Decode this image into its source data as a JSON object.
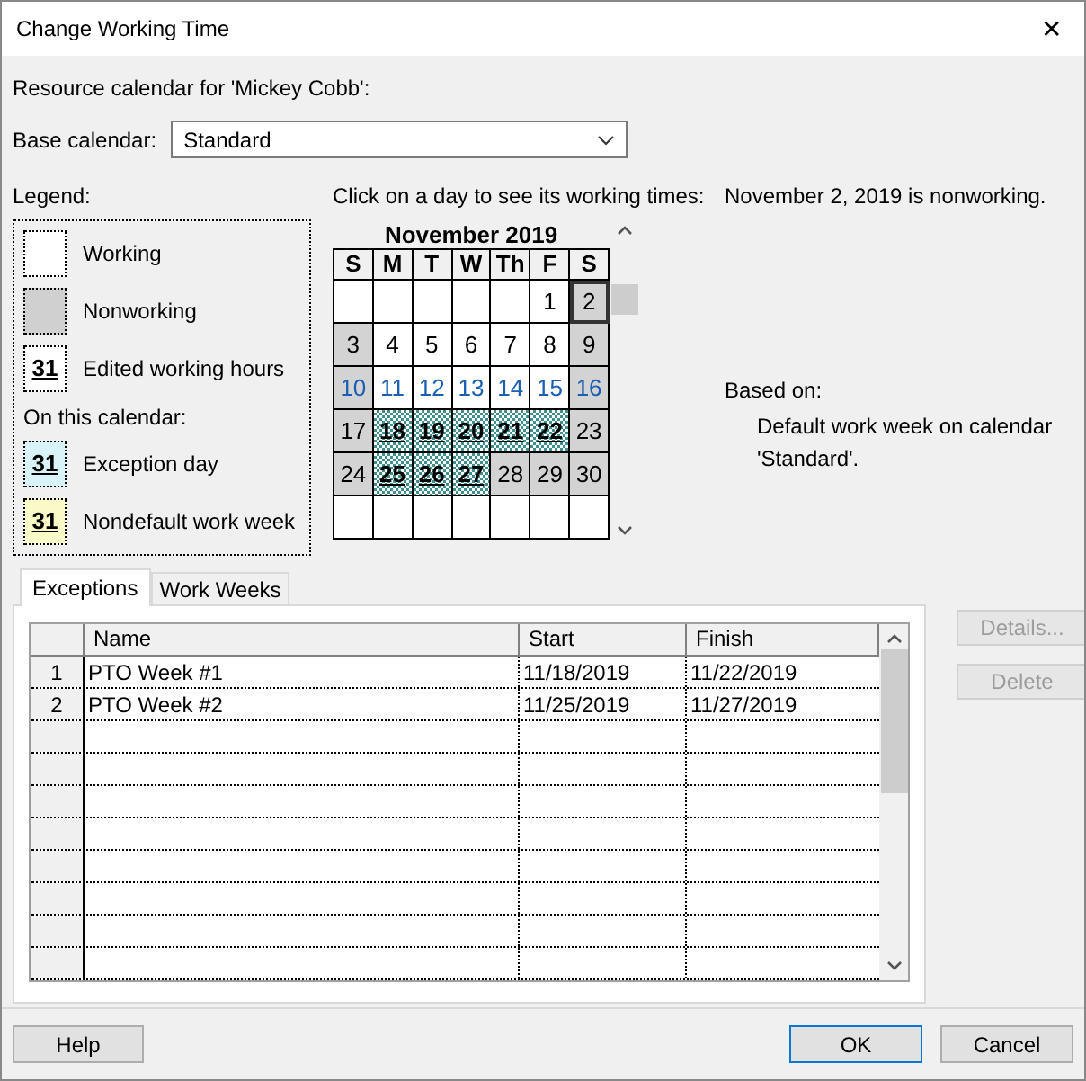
{
  "window": {
    "title": "Change Working Time",
    "close": "✕"
  },
  "resource_label": "Resource calendar for 'Mickey Cobb':",
  "base_calendar": {
    "label": "Base calendar:",
    "value": "Standard"
  },
  "legend": {
    "title": "Legend:",
    "items": [
      {
        "kind": "working",
        "label": "Working"
      },
      {
        "kind": "nonworking",
        "label": "Nonworking"
      },
      {
        "kind": "edited",
        "label": "Edited working hours",
        "sample": "31"
      }
    ],
    "section_label": "On this calendar:",
    "calendar_items": [
      {
        "kind": "exception",
        "label": "Exception day",
        "sample": "31"
      },
      {
        "kind": "nondefault",
        "label": "Nondefault work week",
        "sample": "31"
      }
    ]
  },
  "calendar": {
    "instruction": "Click on a day to see its working times:",
    "month": "November 2019",
    "weekdays": [
      "S",
      "M",
      "T",
      "W",
      "Th",
      "F",
      "S"
    ],
    "days": [
      {
        "kind": "blank",
        "selected": false
      },
      {
        "kind": "blank",
        "selected": false
      },
      {
        "kind": "blank",
        "selected": false
      },
      {
        "kind": "blank",
        "selected": false
      },
      {
        "kind": "blank",
        "selected": false
      },
      {
        "kind": "working",
        "text": "1",
        "selected": false,
        "current_week": false
      },
      {
        "kind": "nonworking",
        "text": "2",
        "selected": true,
        "current_week": false
      },
      {
        "kind": "nonworking",
        "text": "3",
        "selected": false,
        "current_week": false
      },
      {
        "kind": "working",
        "text": "4",
        "selected": false,
        "current_week": false
      },
      {
        "kind": "working",
        "text": "5",
        "selected": false,
        "current_week": false
      },
      {
        "kind": "working",
        "text": "6",
        "selected": false,
        "current_week": false
      },
      {
        "kind": "working",
        "text": "7",
        "selected": false,
        "current_week": false
      },
      {
        "kind": "working",
        "text": "8",
        "selected": false,
        "current_week": false
      },
      {
        "kind": "nonworking",
        "text": "9",
        "selected": false,
        "current_week": false
      },
      {
        "kind": "nonworking",
        "text": "10",
        "selected": false,
        "current_week": true
      },
      {
        "kind": "working",
        "text": "11",
        "selected": false,
        "current_week": true
      },
      {
        "kind": "working",
        "text": "12",
        "selected": false,
        "current_week": true
      },
      {
        "kind": "working",
        "text": "13",
        "selected": false,
        "current_week": true
      },
      {
        "kind": "working",
        "text": "14",
        "selected": false,
        "current_week": true
      },
      {
        "kind": "working",
        "text": "15",
        "selected": false,
        "current_week": true
      },
      {
        "kind": "nonworking",
        "text": "16",
        "selected": false,
        "current_week": true
      },
      {
        "kind": "nonworking",
        "text": "17",
        "selected": false,
        "current_week": false
      },
      {
        "kind": "exception",
        "text": "18",
        "selected": false,
        "current_week": false
      },
      {
        "kind": "exception",
        "text": "19",
        "selected": false,
        "current_week": false
      },
      {
        "kind": "exception",
        "text": "20",
        "selected": false,
        "current_week": false
      },
      {
        "kind": "exception",
        "text": "21",
        "selected": false,
        "current_week": false
      },
      {
        "kind": "exception",
        "text": "22",
        "selected": false,
        "current_week": false
      },
      {
        "kind": "nonworking",
        "text": "23",
        "selected": false,
        "current_week": false
      },
      {
        "kind": "nonworking",
        "text": "24",
        "selected": false,
        "current_week": false
      },
      {
        "kind": "exception",
        "text": "25",
        "selected": false,
        "current_week": false
      },
      {
        "kind": "exception",
        "text": "26",
        "selected": false,
        "current_week": false
      },
      {
        "kind": "exception",
        "text": "27",
        "selected": false,
        "current_week": false
      },
      {
        "kind": "nonworking",
        "text": "28",
        "selected": false,
        "current_week": false
      },
      {
        "kind": "nonworking",
        "text": "29",
        "selected": false,
        "current_week": false
      },
      {
        "kind": "nonworking",
        "text": "30",
        "selected": false,
        "current_week": false
      },
      {
        "kind": "blank",
        "selected": false
      },
      {
        "kind": "blank",
        "selected": false
      },
      {
        "kind": "blank",
        "selected": false
      },
      {
        "kind": "blank",
        "selected": false
      },
      {
        "kind": "blank",
        "selected": false
      },
      {
        "kind": "blank",
        "selected": false
      },
      {
        "kind": "blank",
        "selected": false
      }
    ]
  },
  "day_info": {
    "status": "November 2, 2019 is nonworking.",
    "based_on_label": "Based on:",
    "based_on_text": "Default work week on calendar 'Standard'."
  },
  "tabs": [
    {
      "label": "Exceptions",
      "selected": true
    },
    {
      "label": "Work Weeks",
      "selected": false
    }
  ],
  "table": {
    "columns": [
      "Name",
      "Start",
      "Finish"
    ],
    "rows": [
      {
        "num": "1",
        "name": "PTO Week #1",
        "start": "11/18/2019",
        "finish": "11/22/2019"
      },
      {
        "num": "2",
        "name": "PTO Week #2",
        "start": "11/25/2019",
        "finish": "11/27/2019"
      }
    ]
  },
  "side_buttons": [
    {
      "label": "Details...",
      "disabled": true
    },
    {
      "label": "Delete",
      "disabled": true
    }
  ],
  "footer": {
    "help": {
      "label": "Help"
    },
    "ok": "OK",
    "cancel": "Cancel"
  }
}
